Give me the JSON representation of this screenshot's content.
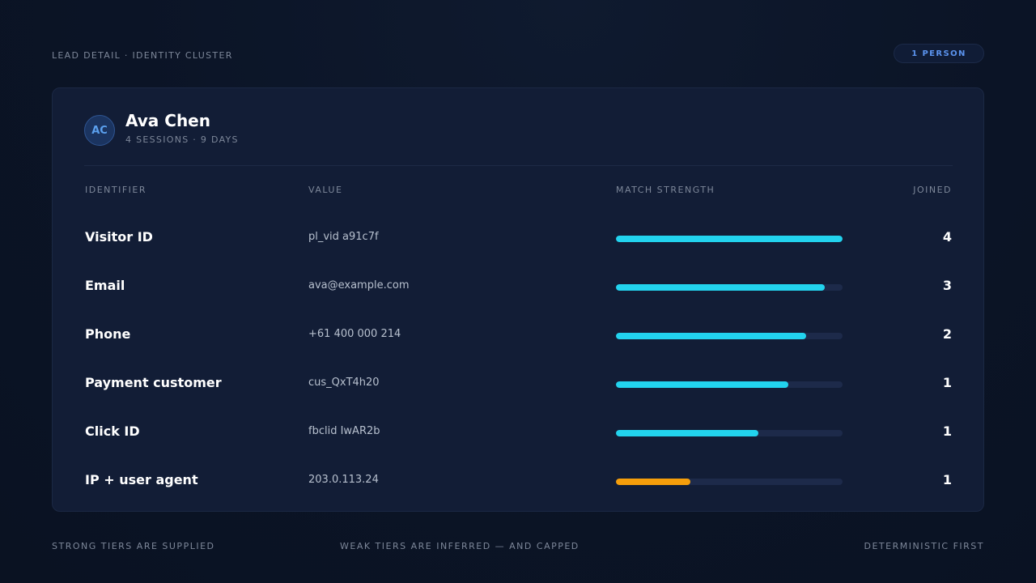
{
  "header": {
    "breadcrumb": "LEAD DETAIL · IDENTITY CLUSTER",
    "badge": "1 PERSON"
  },
  "person": {
    "initials": "AC",
    "name": "Ava Chen",
    "meta": "4 SESSIONS · 9 DAYS"
  },
  "table": {
    "columns": {
      "identifier": "IDENTIFIER",
      "value": "VALUE",
      "strength": "MATCH STRENGTH",
      "joined": "JOINED"
    },
    "rows": [
      {
        "identifier": "Visitor ID",
        "value": "pl_vid a91c7f",
        "strength": 1.0,
        "tier": "strong",
        "joined": "4"
      },
      {
        "identifier": "Email",
        "value": "ava@example.com",
        "strength": 0.92,
        "tier": "strong",
        "joined": "3"
      },
      {
        "identifier": "Phone",
        "value": "+61 400 000 214",
        "strength": 0.84,
        "tier": "strong",
        "joined": "2"
      },
      {
        "identifier": "Payment customer",
        "value": "cus_QxT4h20",
        "strength": 0.76,
        "tier": "strong",
        "joined": "1"
      },
      {
        "identifier": "Click ID",
        "value": "fbclid IwAR2b",
        "strength": 0.63,
        "tier": "strong",
        "joined": "1"
      },
      {
        "identifier": "IP + user agent",
        "value": "203.0.113.24",
        "strength": 0.33,
        "tier": "weak",
        "joined": "1"
      }
    ]
  },
  "colors": {
    "strong": "#22d3ee",
    "weak": "#f59e0b"
  },
  "footer": {
    "left": "STRONG TIERS ARE SUPPLIED",
    "middle": "WEAK TIERS ARE INFERRED — AND CAPPED",
    "right": "DETERMINISTIC FIRST"
  }
}
